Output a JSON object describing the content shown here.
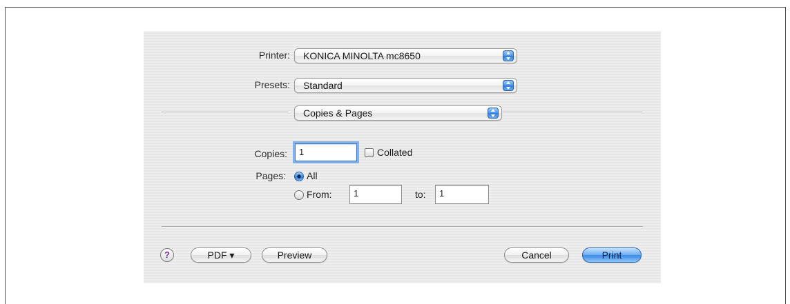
{
  "printer": {
    "label": "Printer:",
    "value": "KONICA MINOLTA mc8650",
    "icon": "popup-stepper-icon"
  },
  "presets": {
    "label": "Presets:",
    "value": "Standard"
  },
  "panel": {
    "value": "Copies & Pages"
  },
  "copies": {
    "label": "Copies:",
    "value": "1",
    "collated_label": "Collated",
    "collated_checked": false
  },
  "pages": {
    "label": "Pages:",
    "all_label": "All",
    "all_selected": true,
    "from_label": "From:",
    "from_value": "1",
    "to_label": "to:",
    "to_value": "1"
  },
  "footer": {
    "help_label": "?",
    "pdf_label": "PDF ▾",
    "preview_label": "Preview",
    "cancel_label": "Cancel",
    "print_label": "Print"
  },
  "colors": {
    "accent": "#3b89e3",
    "help_glyph": "#7a2fa8"
  }
}
